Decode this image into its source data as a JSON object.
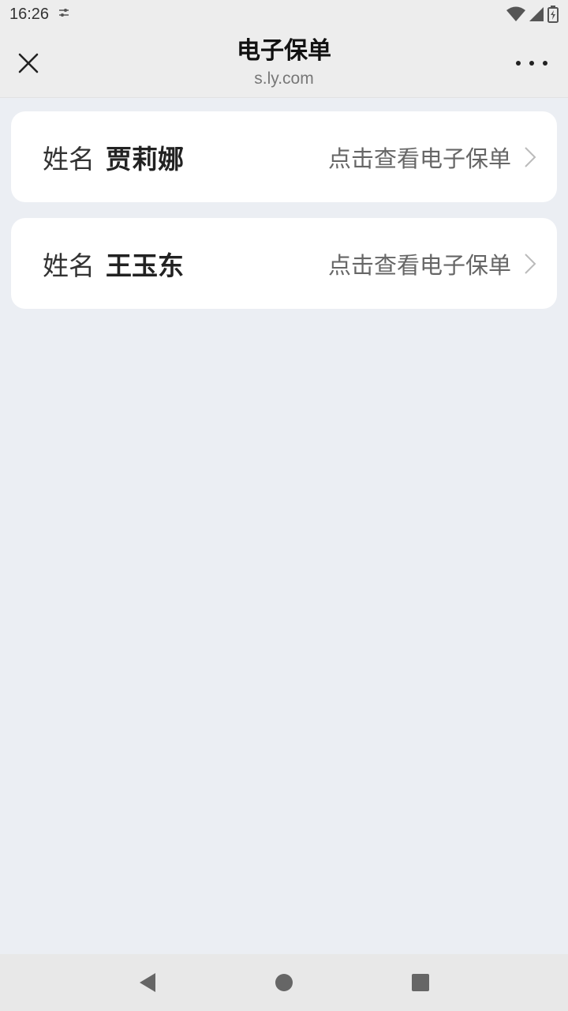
{
  "status_bar": {
    "time": "16:26",
    "icons": [
      "settings-slider-icon",
      "wifi-icon",
      "signal-icon",
      "battery-charging-icon"
    ]
  },
  "header": {
    "title": "电子保单",
    "domain": "s.ly.com",
    "close_icon": "close-icon",
    "more_icon": "more-icon"
  },
  "policies": [
    {
      "label": "姓名",
      "name": "贾莉娜",
      "action": "点击查看电子保单"
    },
    {
      "label": "姓名",
      "name": "王玉东",
      "action": "点击查看电子保单"
    }
  ],
  "nav": {
    "icons": [
      "back-icon",
      "home-icon",
      "recents-icon"
    ]
  },
  "colors": {
    "background": "#ebeef3",
    "header_bg": "#ededed",
    "card_bg": "#ffffff",
    "text_primary": "#222222",
    "text_secondary": "#666666"
  }
}
